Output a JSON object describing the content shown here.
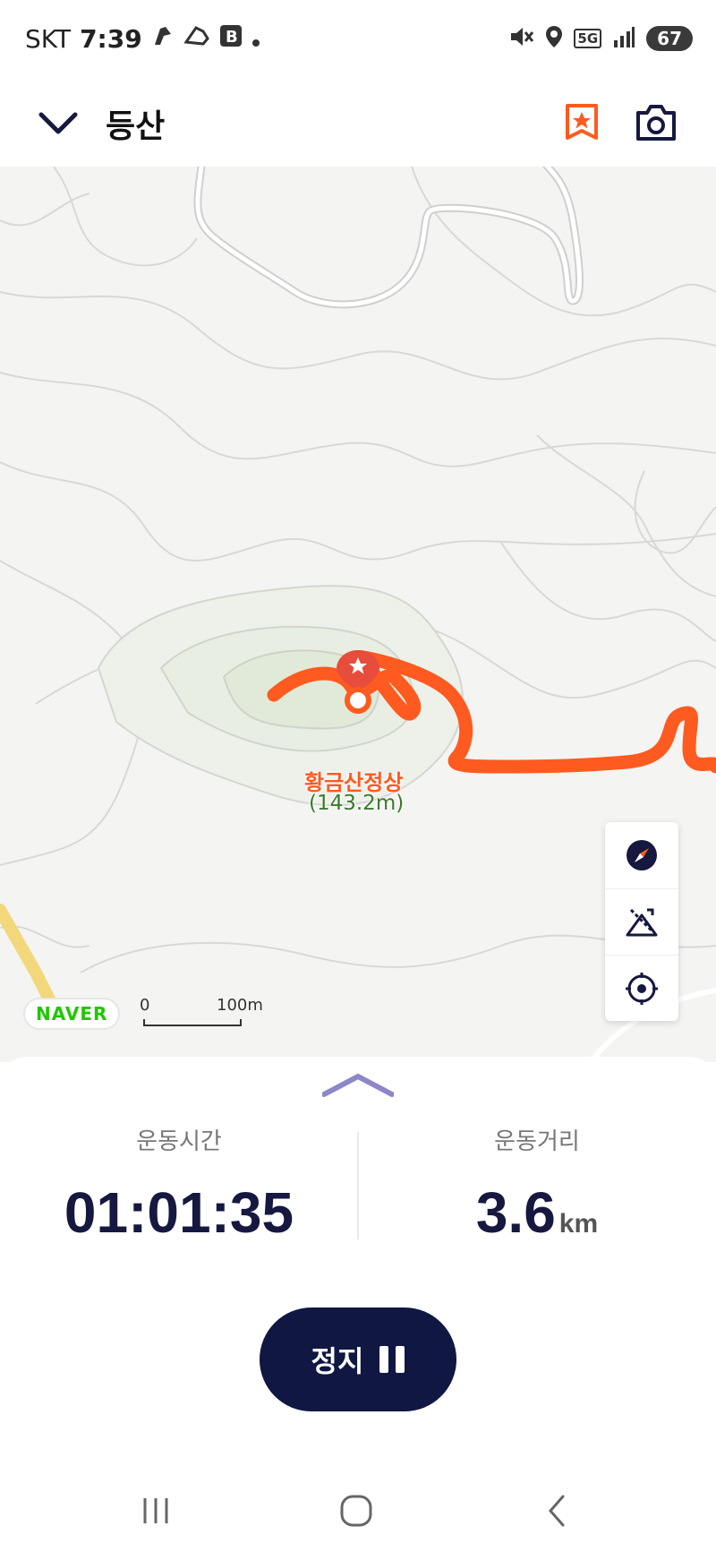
{
  "status": {
    "carrier": "SKT",
    "time": "7:39",
    "battery": "67",
    "network": "5G"
  },
  "header": {
    "title": "등산",
    "icons": [
      "chevron-down-icon",
      "bookmark-star-icon",
      "camera-icon"
    ]
  },
  "map": {
    "peak_name": "황금산정상",
    "peak_elevation": "(143.2m)",
    "provider_logo": "NAVER",
    "scale_start": "0",
    "scale_end": "100m",
    "route_color": "#ff5a1f",
    "tools": [
      "compass-icon",
      "elevation-icon",
      "locate-icon"
    ]
  },
  "stats": {
    "time_label": "운동시간",
    "time_value": "01:01:35",
    "distance_label": "운동거리",
    "distance_value": "3.6",
    "distance_unit": "km"
  },
  "controls": {
    "stop_label": "정지"
  },
  "colors": {
    "primary_dark": "#0f1742",
    "accent": "#ff5a1f",
    "handle": "#8c87c9"
  }
}
